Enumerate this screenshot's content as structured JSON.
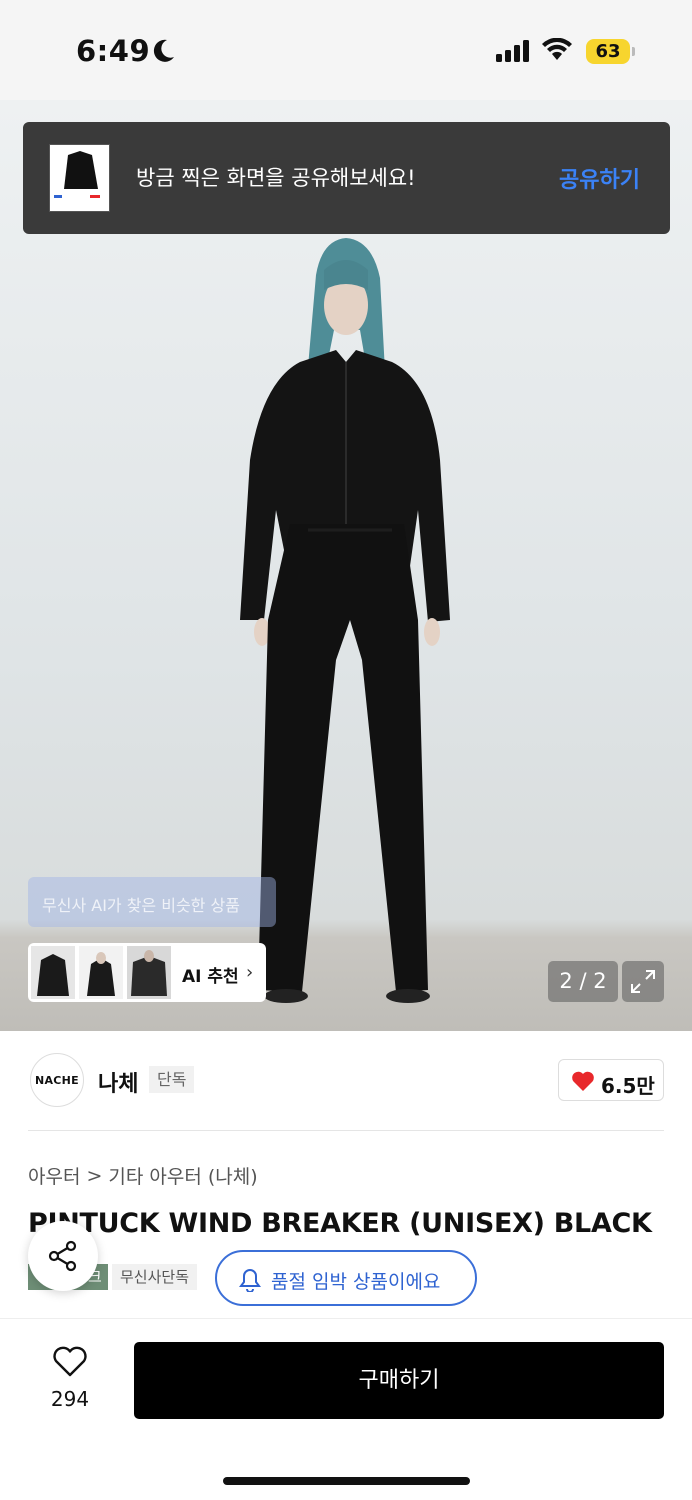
{
  "status_bar": {
    "time": "6:49",
    "battery": "63"
  },
  "toast": {
    "message": "방금 찍은 화면을 공유해보세요!",
    "action": "공유하기"
  },
  "gallery": {
    "ai_hint": "무신사 AI가 찾은 비슷한 상품",
    "ai_recommend_label": "AI 추천",
    "counter": "2 / 2"
  },
  "brand": {
    "logo_text": "NACHE",
    "name": "나체",
    "badge": "단독",
    "like_count": "6.5만"
  },
  "breadcrumb": {
    "level1": "아우터",
    "separator": ">",
    "level2": "기타 아우터 (나체)"
  },
  "product": {
    "title": "PINTUCK WIND BREAKER (UNISEX) BLACK",
    "tag_partial": "크",
    "tag_exclusive": "무신사단독",
    "restock_label": "품절 임박 상품이에요"
  },
  "bottom_bar": {
    "like_count": "294",
    "buy_label": "구매하기"
  },
  "colors": {
    "accent_blue": "#2f63d1",
    "like_red": "#e8282b",
    "tag_green": "#6e8e76"
  },
  "icons": [
    "moon-icon",
    "signal-icon",
    "wifi-icon",
    "expand-icon",
    "heart-icon",
    "bell-icon",
    "share-icon",
    "chevron-right-icon"
  ]
}
